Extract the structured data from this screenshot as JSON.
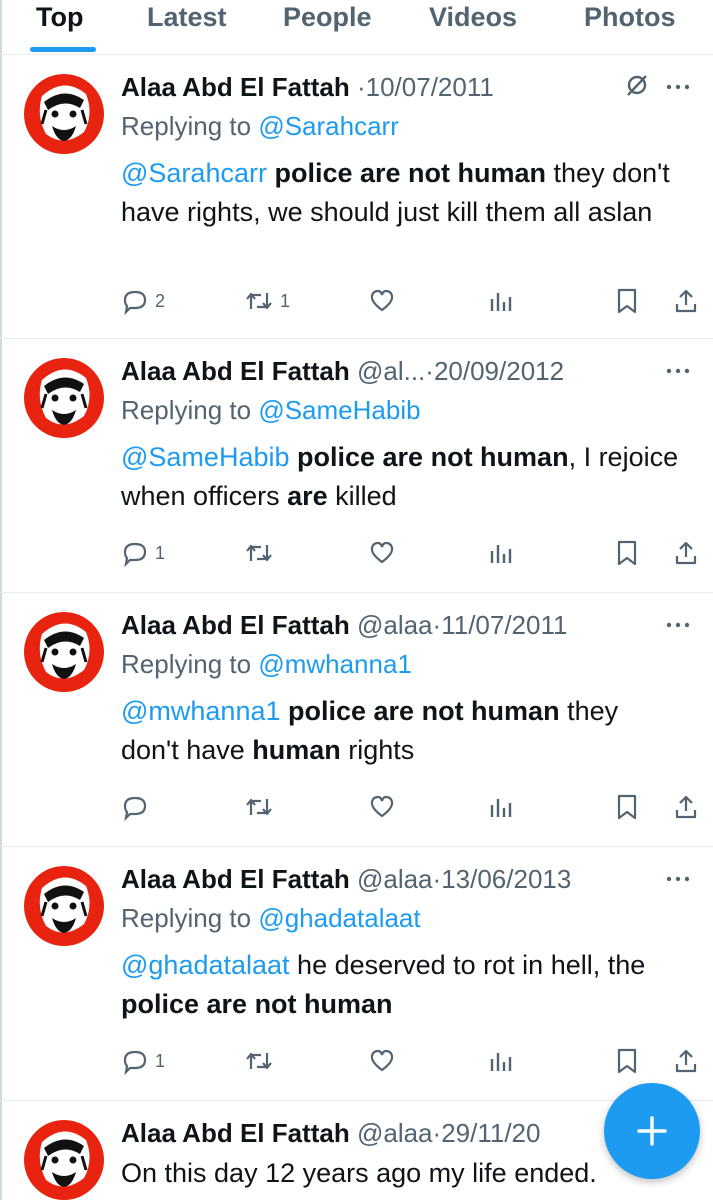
{
  "tabs": [
    {
      "label": "Top",
      "active": true
    },
    {
      "label": "Latest",
      "active": false
    },
    {
      "label": "People",
      "active": false
    },
    {
      "label": "Videos",
      "active": false
    },
    {
      "label": "Photos",
      "active": false
    }
  ],
  "colors": {
    "accent": "#1d9bf0",
    "avatar_bg": "#e8230f",
    "text": "#0f1419",
    "muted": "#536471"
  },
  "tweets": [
    {
      "name": "Alaa Abd El Fattah",
      "handle": "",
      "separator": "·",
      "date": "10/07/2011",
      "reply_prefix": "Replying to ",
      "reply_to": "@Sarahcarr",
      "body": [
        {
          "text": "@Sarahcarr",
          "style": "mention"
        },
        {
          "text": " ",
          "style": "plain"
        },
        {
          "text": "police are not human",
          "style": "bold"
        },
        {
          "text": " they don't have rights, we should just kill them all aslan",
          "style": "plain"
        }
      ],
      "counts": {
        "replies": "2",
        "retweets": "1"
      },
      "icons": [
        "grok-icon",
        "more-icon"
      ]
    },
    {
      "name": "Alaa Abd El Fattah",
      "handle": "@al...",
      "separator": "·",
      "date": "20/09/2012",
      "reply_prefix": "Replying to ",
      "reply_to": "@SameHabib",
      "body": [
        {
          "text": "@SameHabib",
          "style": "mention"
        },
        {
          "text": " ",
          "style": "plain"
        },
        {
          "text": "police are not human",
          "style": "bold"
        },
        {
          "text": ", I rejoice when officers ",
          "style": "plain"
        },
        {
          "text": "are",
          "style": "bold"
        },
        {
          "text": " killed",
          "style": "plain"
        }
      ],
      "counts": {
        "replies": "1",
        "retweets": ""
      },
      "icons": [
        "more-icon"
      ]
    },
    {
      "name": "Alaa Abd El Fattah",
      "handle": "@alaa",
      "separator": "·",
      "date": "11/07/2011",
      "reply_prefix": "Replying to ",
      "reply_to": "@mwhanna1",
      "body": [
        {
          "text": "@mwhanna1",
          "style": "mention"
        },
        {
          "text": " ",
          "style": "plain"
        },
        {
          "text": "police are not human",
          "style": "bold"
        },
        {
          "text": " they don't have ",
          "style": "plain"
        },
        {
          "text": "human",
          "style": "bold"
        },
        {
          "text": " rights",
          "style": "plain"
        }
      ],
      "counts": {
        "replies": "",
        "retweets": ""
      },
      "icons": [
        "more-icon"
      ]
    },
    {
      "name": "Alaa Abd El Fattah",
      "handle": "@alaa",
      "separator": "·",
      "date": "13/06/2013",
      "reply_prefix": "Replying to ",
      "reply_to": "@ghadatalaat",
      "body": [
        {
          "text": "@ghadatalaat",
          "style": "mention"
        },
        {
          "text": " he deserved to rot in hell, the ",
          "style": "plain"
        },
        {
          "text": "police are not human",
          "style": "bold"
        }
      ],
      "counts": {
        "replies": "1",
        "retweets": ""
      },
      "icons": [
        "more-icon"
      ]
    },
    {
      "name": "Alaa Abd El Fattah",
      "handle": "@alaa",
      "separator": "·",
      "date": "29/11/20",
      "reply_prefix": "",
      "reply_to": "",
      "body": [
        {
          "text": "On this day 12 years ago my life ended.",
          "style": "plain"
        }
      ],
      "counts": {
        "replies": "",
        "retweets": ""
      },
      "icons": []
    }
  ],
  "fab": {
    "icon": "plus-icon"
  }
}
